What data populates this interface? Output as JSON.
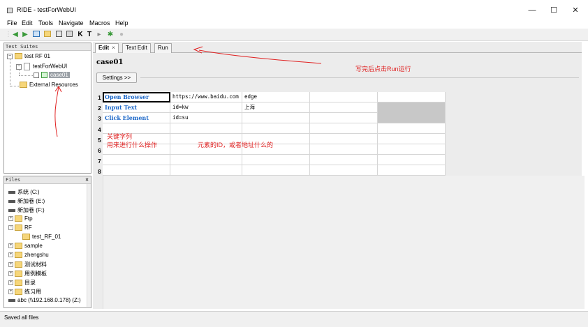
{
  "window": {
    "title": "RIDE - testForWebUI",
    "controls": [
      "—",
      "☐",
      "✕"
    ]
  },
  "menu": [
    "File",
    "Edit",
    "Tools",
    "Navigate",
    "Macros",
    "Help"
  ],
  "toolbar_icons": [
    "back-arrow-icon",
    "forward-arrow-icon",
    "new-project-icon",
    "open-folder-icon",
    "save-icon",
    "save-all-icon",
    "keyword-icon",
    "text-icon",
    "run-icon",
    "stop-icon",
    "debug-icon"
  ],
  "test_suites": {
    "caption": "Test Suites",
    "items": [
      {
        "label": "test RF 01",
        "level": 0
      },
      {
        "label": "testForWebUI",
        "level": 1
      },
      {
        "label": "case01",
        "level": 2,
        "selected": true
      },
      {
        "label": "External Resources",
        "level": 0
      }
    ]
  },
  "files": {
    "caption": "Files",
    "close": "×",
    "items": [
      {
        "label": "系统 (C:)",
        "kind": "drive"
      },
      {
        "label": "新加卷 (E:)",
        "kind": "drive"
      },
      {
        "label": "新加卷 (F:)",
        "kind": "drive"
      },
      {
        "label": "Ftp",
        "kind": "folder",
        "indent": 1
      },
      {
        "label": "RF",
        "kind": "folder",
        "indent": 1
      },
      {
        "label": "test_RF_01",
        "kind": "folder",
        "indent": 2
      },
      {
        "label": "sample",
        "kind": "folder",
        "indent": 1
      },
      {
        "label": "zhengshu",
        "kind": "folder",
        "indent": 1
      },
      {
        "label": "测试材料",
        "kind": "folder",
        "indent": 1
      },
      {
        "label": "用例模板",
        "kind": "folder",
        "indent": 1
      },
      {
        "label": "目录",
        "kind": "folder",
        "indent": 1
      },
      {
        "label": "练习用",
        "kind": "folder",
        "indent": 1
      },
      {
        "label": "abc (\\\\192.168.0.178) (Z:)",
        "kind": "drive"
      }
    ]
  },
  "editor": {
    "tabs": [
      {
        "label": "Edit",
        "active": true,
        "close": "×"
      },
      {
        "label": "Text Edit",
        "active": false
      },
      {
        "label": "Run",
        "active": false
      }
    ],
    "case_title": "case01",
    "settings_label": "Settings >>",
    "row_numbers": [
      "1",
      "2",
      "3",
      "4",
      "5",
      "6",
      "7",
      "8"
    ],
    "rows": [
      [
        "Open Browser",
        "https://www.baidu.com",
        "edge",
        "",
        ""
      ],
      [
        "Input Text",
        "id=kw",
        "上海",
        "",
        ""
      ],
      [
        "Click Element",
        "id=su",
        "",
        "",
        ""
      ]
    ]
  },
  "annotations": {
    "run_note": "写完后点击Run运行",
    "keyword_note_1": "关键字列",
    "keyword_note_2": "用来进行什么操作",
    "locator_note": "元素的ID，或者地址什么的"
  },
  "status": "Saved all files",
  "colors": {
    "keyword_blue": "#1a66c7",
    "annotation_red": "#e02020",
    "selected_tree": "#9aa0a6"
  }
}
